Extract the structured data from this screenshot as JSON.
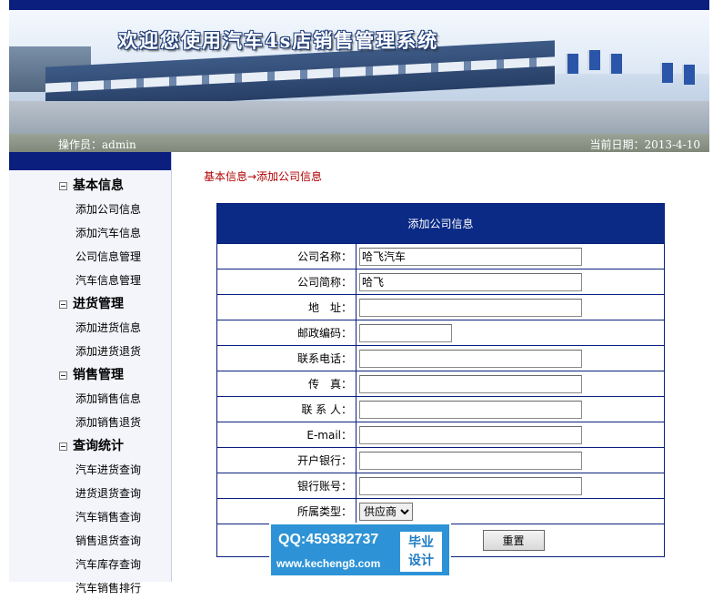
{
  "banner": {
    "title": "欢迎您使用汽车4s店销售管理系统"
  },
  "status": {
    "operator": "操作员：admin",
    "date": "当前日期：2013-4-10"
  },
  "sidebar": {
    "groups": [
      {
        "title": "基本信息",
        "items": [
          "添加公司信息",
          "添加汽车信息",
          "公司信息管理",
          "汽车信息管理"
        ]
      },
      {
        "title": "进货管理",
        "items": [
          "添加进货信息",
          "添加进货退货"
        ]
      },
      {
        "title": "销售管理",
        "items": [
          "添加销售信息",
          "添加销售退货"
        ]
      },
      {
        "title": "查询统计",
        "items": [
          "汽车进货查询",
          "进货退货查询",
          "汽车销售查询",
          "销售退货查询",
          "汽车库存查询",
          "汽车销售排行"
        ]
      }
    ]
  },
  "main": {
    "breadcrumb": "基本信息→添加公司信息",
    "form_title": "添加公司信息",
    "fields": [
      {
        "label": "公司名称：",
        "value": "哈飞汽车"
      },
      {
        "label": "公司简称：",
        "value": "哈飞"
      },
      {
        "label": "地　址：",
        "value": ""
      },
      {
        "label": "邮政编码：",
        "value": ""
      },
      {
        "label": "联系电话：",
        "value": ""
      },
      {
        "label": "传　真：",
        "value": ""
      },
      {
        "label": "联 系 人：",
        "value": ""
      },
      {
        "label": "E-mail：",
        "value": ""
      },
      {
        "label": "开户银行：",
        "value": ""
      },
      {
        "label": "银行账号：",
        "value": ""
      }
    ],
    "type_label": "所属类型：",
    "type_selected": "供应商",
    "reset_label": "重置"
  },
  "watermark": {
    "qq": "QQ:459382737",
    "url": "www.kecheng8.com",
    "badge1": "毕业",
    "badge2": "设计"
  }
}
